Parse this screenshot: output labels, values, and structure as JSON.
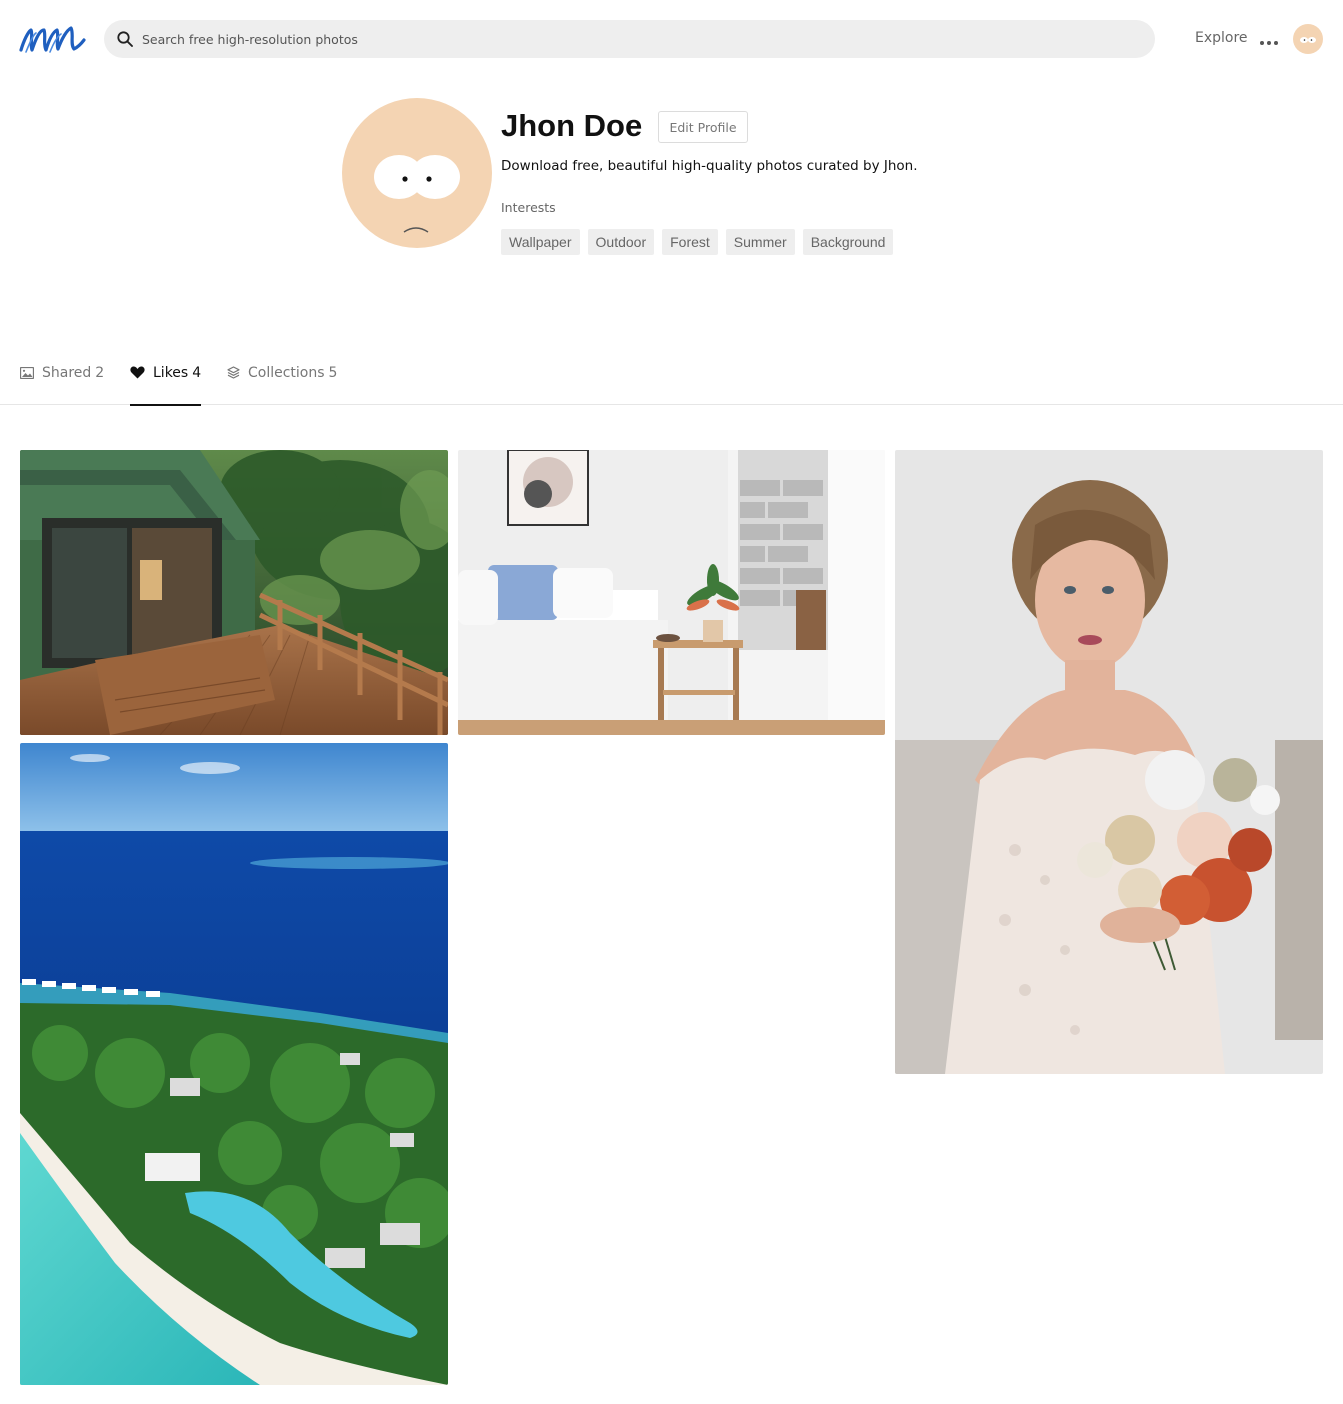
{
  "header": {
    "logo_alt": "m",
    "search_placeholder": "Search free high-resolution photos",
    "explore_label": "Explore"
  },
  "profile": {
    "name": "Jhon Doe",
    "edit_label": "Edit Profile",
    "bio": "Download free, beautiful high-quality photos curated by Jhon.",
    "interests_label": "Interests",
    "interests": [
      "Wallpaper",
      "Outdoor",
      "Forest",
      "Summer",
      "Background"
    ]
  },
  "tabs": [
    {
      "label": "Shared",
      "count": "2",
      "icon": "image-icon",
      "active": false
    },
    {
      "label": "Likes",
      "count": "4",
      "icon": "heart-icon",
      "active": true
    },
    {
      "label": "Collections",
      "count": "5",
      "icon": "layers-icon",
      "active": false
    }
  ],
  "photos": [
    {
      "subject": "forest-cabin-deck"
    },
    {
      "subject": "white-bedroom"
    },
    {
      "subject": "bride-with-bouquet"
    },
    {
      "subject": "tropical-island-resort"
    }
  ],
  "colors": {
    "accent_logo": "#1f5fbf",
    "avatar_skin": "#f4d4b3",
    "search_bg": "#eeeeee",
    "tag_bg": "#eeeeee"
  }
}
